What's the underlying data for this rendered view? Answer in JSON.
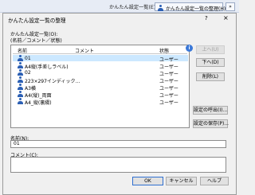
{
  "taskbar": {
    "label": "かんたん設定一覧(E):",
    "button_label": "かんたん設定一覧の整理(H)...",
    "more": "»"
  },
  "dialog": {
    "title": "かんたん設定一覧の整理",
    "help_symbol": "?",
    "close_symbol": "×"
  },
  "list": {
    "label": "かんたん設定一覧(O):\n(名前／コメント／状態)",
    "headers": {
      "name": "名前",
      "comment": "コメント",
      "status": "状態"
    },
    "rows": [
      {
        "name": "01",
        "status": "ユーザー",
        "selected": true
      },
      {
        "name": "A4縦(手差しラベル)",
        "status": "ユーザー"
      },
      {
        "name": "02",
        "status": "ユーザー"
      },
      {
        "name": "223×297インディック...",
        "status": "ユーザー"
      },
      {
        "name": "A3横",
        "status": "ユーザー"
      },
      {
        "name": "A4(縦)_両面",
        "status": "ユーザー"
      },
      {
        "name": "A4_縦(裏綴)",
        "status": "ユーザー"
      }
    ]
  },
  "side_buttons": {
    "up": "上へ(U)",
    "down": "下へ(D)",
    "delete": "削除(L)",
    "import": "設定の呼出(I)...",
    "save": "設定の保存(P)..."
  },
  "form": {
    "name_label": "名前(N):",
    "name_value": "01",
    "comment_label": "コメント(C):",
    "comment_value": ""
  },
  "footer": {
    "ok": "OK",
    "cancel": "キャンセル",
    "help": "ヘルプ"
  },
  "icons": {
    "user": "user-icon",
    "info": "info-icon"
  },
  "colors": {
    "selection": "#cce8ff",
    "icon": "#2b5fb4",
    "info": "#3a78d8",
    "default_button_border": "#2f6fd0"
  }
}
